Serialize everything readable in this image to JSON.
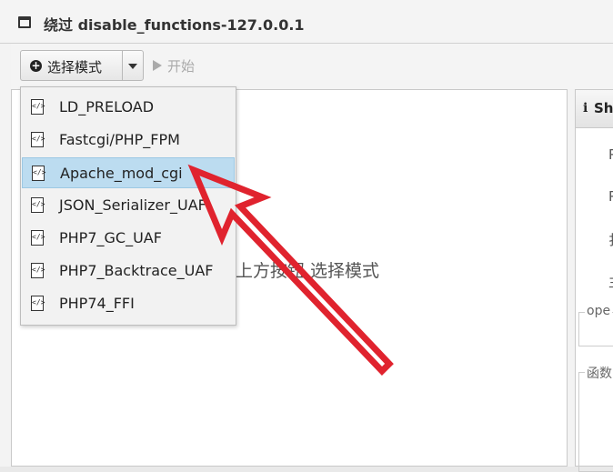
{
  "window": {
    "title": "绕过 disable_functions-127.0.0.1"
  },
  "toolbar": {
    "mode_button_label": "选择模式",
    "start_button_label": "开始"
  },
  "main": {
    "hint_text": "上方按钮,选择模式"
  },
  "side": {
    "title": "Sh",
    "field_1": "P",
    "field_2": "P",
    "field_3": "扌",
    "field_4": "主",
    "legend_1": "ope",
    "legend_2": "函数"
  },
  "menu": {
    "items": [
      {
        "label": "LD_PRELOAD",
        "selected": false
      },
      {
        "label": "Fastcgi/PHP_FPM",
        "selected": false
      },
      {
        "label": "Apache_mod_cgi",
        "selected": true
      },
      {
        "label": "JSON_Serializer_UAF",
        "selected": false
      },
      {
        "label": "PHP7_GC_UAF",
        "selected": false
      },
      {
        "label": "PHP7_Backtrace_UAF",
        "selected": false
      },
      {
        "label": "PHP74_FFI",
        "selected": false
      }
    ]
  },
  "colors": {
    "selection_bg": "#bcdcf0",
    "annotation_arrow": "#e0232e"
  }
}
